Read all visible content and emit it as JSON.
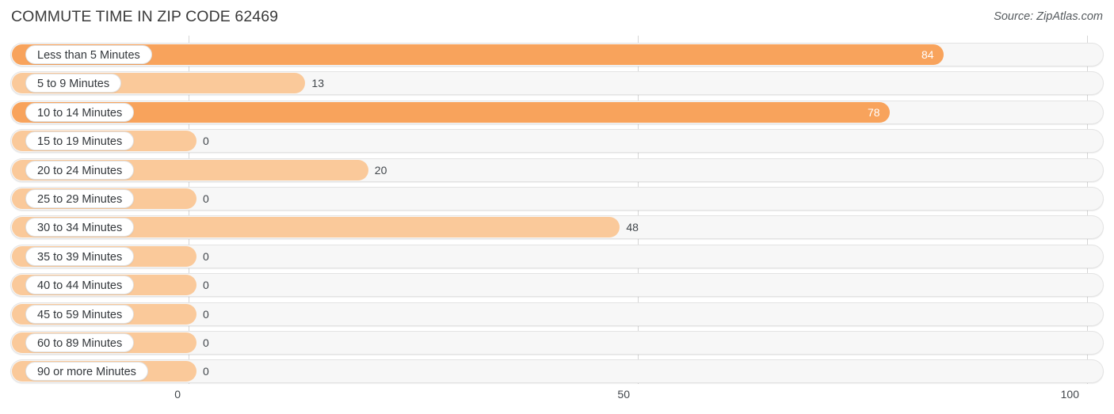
{
  "header": {
    "title": "COMMUTE TIME IN ZIP CODE 62469",
    "source": "Source: ZipAtlas.com"
  },
  "colors": {
    "bar_strong": "#f8a35c",
    "bar_light": "#fac99a",
    "track_bg": "#f7f7f7",
    "track_border": "#e3e3e3",
    "gridline": "#d6d6d6",
    "text": "#33373b",
    "value_in": "#ffffff"
  },
  "axis": {
    "ticks": [
      "0",
      "50",
      "100"
    ],
    "tick_values": [
      0,
      50,
      100
    ],
    "min": 0,
    "max": 100
  },
  "chart_data": {
    "type": "bar",
    "orientation": "horizontal",
    "title": "COMMUTE TIME IN ZIP CODE 62469",
    "subtitle": "Source: ZipAtlas.com",
    "xlabel": "",
    "ylabel": "",
    "xlim": [
      0,
      100
    ],
    "grid": true,
    "legend": "none",
    "xticks": [
      0,
      50,
      100
    ],
    "categories": [
      "Less than 5 Minutes",
      "5 to 9 Minutes",
      "10 to 14 Minutes",
      "15 to 19 Minutes",
      "20 to 24 Minutes",
      "25 to 29 Minutes",
      "30 to 34 Minutes",
      "35 to 39 Minutes",
      "40 to 44 Minutes",
      "45 to 59 Minutes",
      "60 to 89 Minutes",
      "90 or more Minutes"
    ],
    "values": [
      84,
      13,
      78,
      0,
      20,
      0,
      48,
      0,
      0,
      0,
      0,
      0
    ],
    "value_labels": [
      "84",
      "13",
      "78",
      "0",
      "20",
      "0",
      "48",
      "0",
      "0",
      "0",
      "0",
      "0"
    ]
  },
  "rows": [
    {
      "label": "Less than 5 Minutes",
      "value": 84,
      "value_label": "84",
      "shade": "strong",
      "label_inside": true
    },
    {
      "label": "5 to 9 Minutes",
      "value": 13,
      "value_label": "13",
      "shade": "light",
      "label_inside": false
    },
    {
      "label": "10 to 14 Minutes",
      "value": 78,
      "value_label": "78",
      "shade": "strong",
      "label_inside": true
    },
    {
      "label": "15 to 19 Minutes",
      "value": 0,
      "value_label": "0",
      "shade": "light",
      "label_inside": false
    },
    {
      "label": "20 to 24 Minutes",
      "value": 20,
      "value_label": "20",
      "shade": "light",
      "label_inside": false
    },
    {
      "label": "25 to 29 Minutes",
      "value": 0,
      "value_label": "0",
      "shade": "light",
      "label_inside": false
    },
    {
      "label": "30 to 34 Minutes",
      "value": 48,
      "value_label": "48",
      "shade": "light",
      "label_inside": false
    },
    {
      "label": "35 to 39 Minutes",
      "value": 0,
      "value_label": "0",
      "shade": "light",
      "label_inside": false
    },
    {
      "label": "40 to 44 Minutes",
      "value": 0,
      "value_label": "0",
      "shade": "light",
      "label_inside": false
    },
    {
      "label": "45 to 59 Minutes",
      "value": 0,
      "value_label": "0",
      "shade": "light",
      "label_inside": false
    },
    {
      "label": "60 to 89 Minutes",
      "value": 0,
      "value_label": "0",
      "shade": "light",
      "label_inside": false
    },
    {
      "label": "90 or more Minutes",
      "value": 0,
      "value_label": "0",
      "shade": "light",
      "label_inside": false
    }
  ]
}
